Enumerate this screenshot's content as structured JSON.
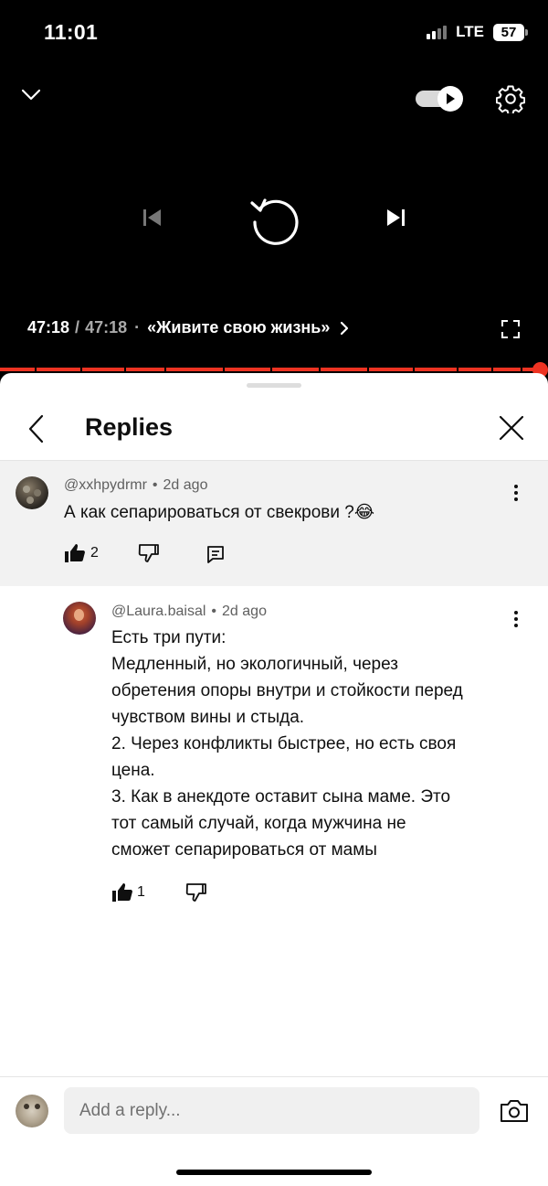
{
  "status_bar": {
    "time": "11:01",
    "network": "LTE",
    "battery": "57"
  },
  "player": {
    "current_time": "47:18",
    "separator": "/",
    "duration": "47:18",
    "dot": "·",
    "chapter": "«Живите свою жизнь»",
    "autoplay_on": true,
    "icons": [
      "chevron-down-icon",
      "autoplay-toggle-icon",
      "gear-icon",
      "previous-icon",
      "replay-icon",
      "next-icon",
      "chevron-right-icon",
      "fullscreen-icon"
    ],
    "progress_fraction": 1.0,
    "accent_color": "#ee3322"
  },
  "sheet": {
    "title": "Replies",
    "icons": [
      "back-icon",
      "close-icon"
    ]
  },
  "parent_comment": {
    "author": "@xxhpydrmr",
    "bullet": "•",
    "age": "2d ago",
    "text": "А как сепарироваться от свекрови ?😂",
    "likes": "2",
    "icons": [
      "more-icon",
      "like-icon",
      "dislike-icon",
      "reply-icon"
    ]
  },
  "reply_comment": {
    "author": "@Laura.baisal",
    "bullet": "•",
    "age": "2d ago",
    "lines": [
      "Есть три пути:",
      "Медленный, но экологичный, через",
      "обретения опоры внутри и стойкости перед",
      "чувством вины и стыда.",
      "2. Через конфликты быстрее, но есть своя",
      "цена.",
      "3. Как в анекдоте оставит сына маме. Это",
      "тот самый случай, когда мужчина не",
      "сможет сепарироваться от мамы"
    ],
    "likes": "1",
    "icons": [
      "more-icon",
      "like-icon",
      "dislike-icon"
    ]
  },
  "composer": {
    "placeholder": "Add a reply...",
    "icons": [
      "camera-icon"
    ]
  }
}
